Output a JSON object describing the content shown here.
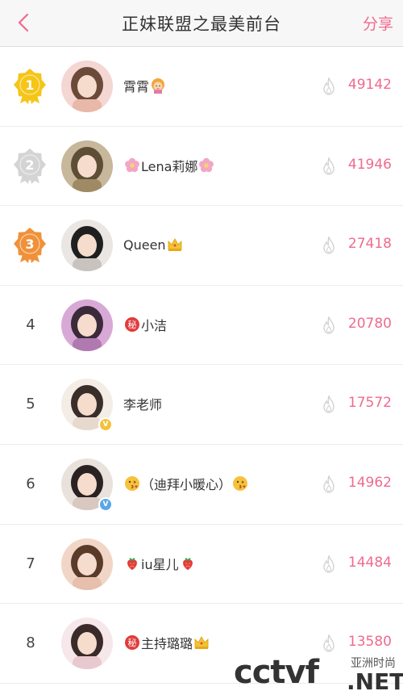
{
  "header": {
    "title": "正妹联盟之最美前台",
    "share_label": "分享"
  },
  "ranking": [
    {
      "rank": "1",
      "badge": "gold",
      "name_prefix": "",
      "name": "霄霄",
      "name_suffix": "",
      "suffix_emoji": "girl",
      "prefix_emoji": "",
      "score": "49142",
      "verified": ""
    },
    {
      "rank": "2",
      "badge": "silver",
      "name_prefix": "",
      "name": "Lena莉娜",
      "suffix_emoji": "flower",
      "prefix_emoji": "flower",
      "score": "41946",
      "verified": ""
    },
    {
      "rank": "3",
      "badge": "bronze",
      "name": "Queen",
      "suffix_emoji": "crown",
      "prefix_emoji": "",
      "score": "27418",
      "verified": ""
    },
    {
      "rank": "4",
      "badge": "",
      "name": "小洁",
      "suffix_emoji": "",
      "prefix_emoji": "secret",
      "score": "20780",
      "verified": ""
    },
    {
      "rank": "5",
      "badge": "",
      "name": "李老师",
      "suffix_emoji": "",
      "prefix_emoji": "",
      "score": "17572",
      "verified": "yellow"
    },
    {
      "rank": "6",
      "badge": "",
      "name": "（迪拜小暖心）",
      "suffix_emoji": "kiss",
      "prefix_emoji": "kiss",
      "score": "14962",
      "verified": "blue"
    },
    {
      "rank": "7",
      "badge": "",
      "name": "iu星儿",
      "suffix_emoji": "strawberry",
      "prefix_emoji": "strawberry",
      "score": "14484",
      "verified": ""
    },
    {
      "rank": "8",
      "badge": "",
      "name": "主持璐璐",
      "suffix_emoji": "crown",
      "prefix_emoji": "secret",
      "score": "13580",
      "verified": ""
    }
  ],
  "watermark": {
    "brand": "cctvf",
    "sub": "亚洲时尚",
    "domain": ".NET"
  },
  "colors": {
    "accent": "#f06a8e",
    "gold": "#f5c518",
    "silver": "#d4d4d4",
    "bronze": "#f0913a"
  }
}
